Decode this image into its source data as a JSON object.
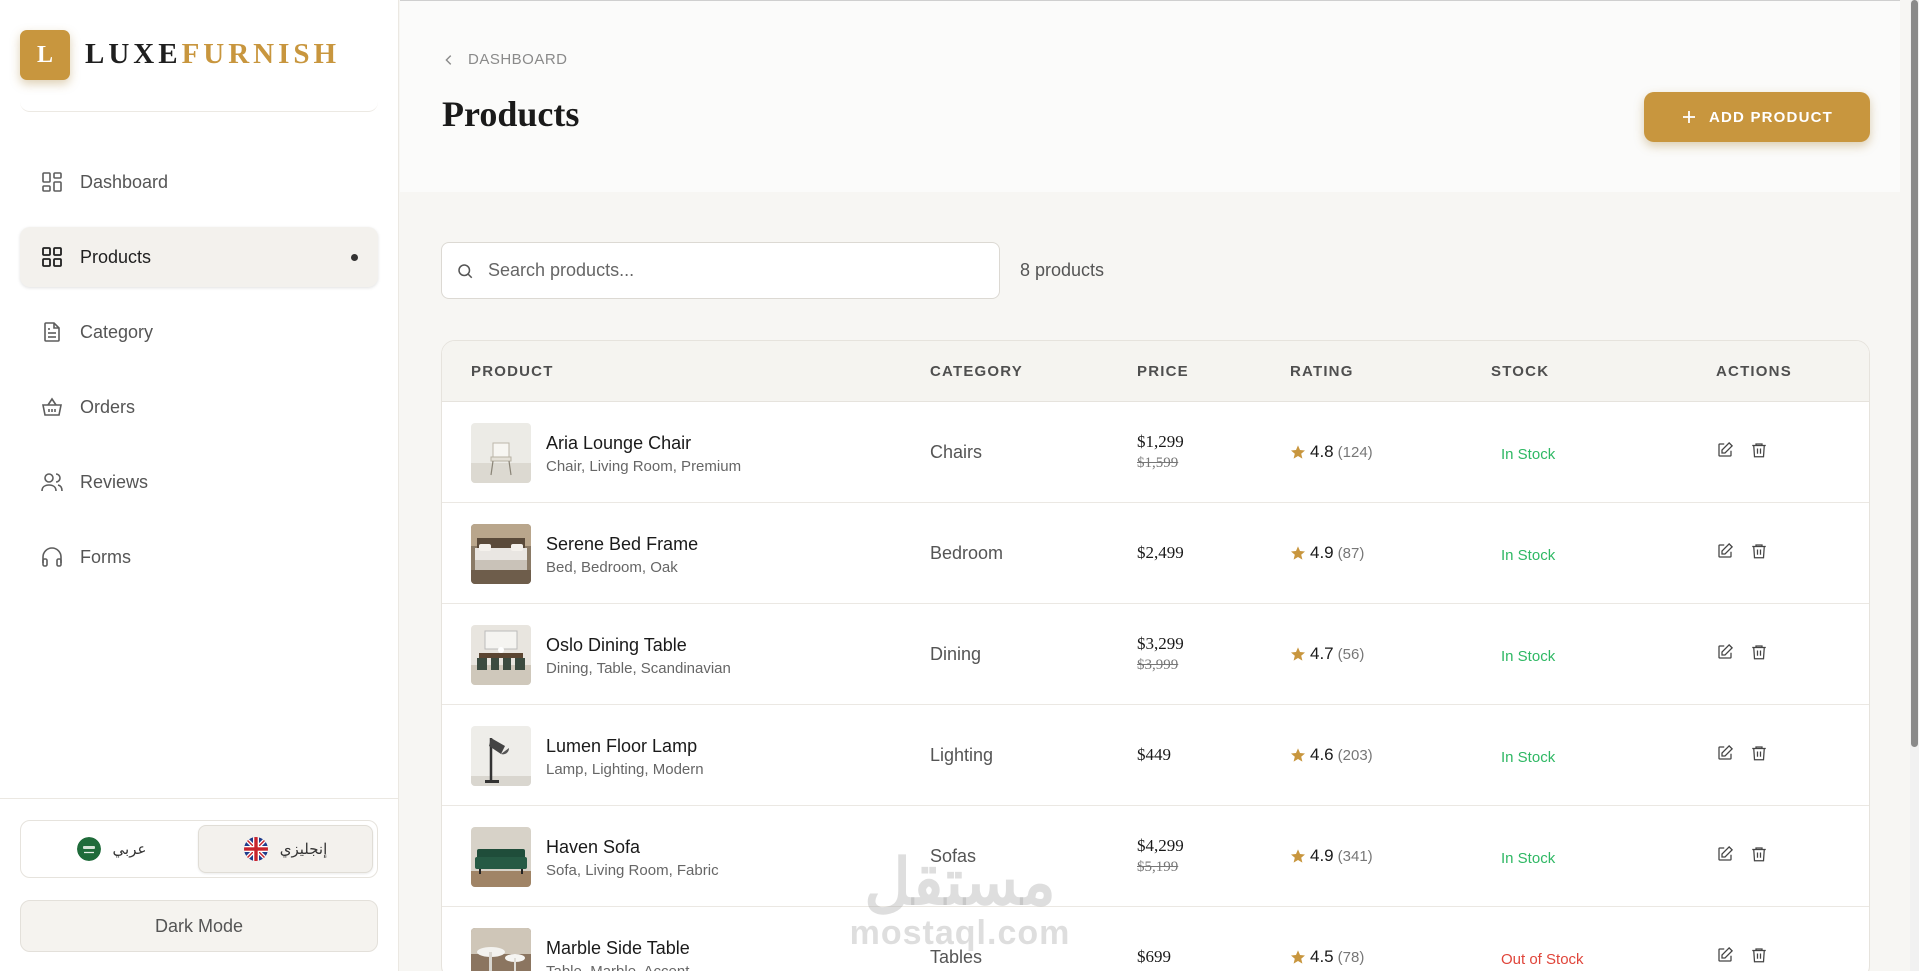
{
  "brand": {
    "logo_letter": "L",
    "name_part1": "LUXE",
    "name_part2": "FURNISH",
    "accent_color": "#c8963e"
  },
  "sidebar": {
    "items": [
      {
        "label": "Dashboard",
        "icon": "dashboard-icon",
        "active": false
      },
      {
        "label": "Products",
        "icon": "grid-icon",
        "active": true
      },
      {
        "label": "Category",
        "icon": "document-icon",
        "active": false
      },
      {
        "label": "Orders",
        "icon": "basket-icon",
        "active": false
      },
      {
        "label": "Reviews",
        "icon": "users-icon",
        "active": false
      },
      {
        "label": "Forms",
        "icon": "headphones-icon",
        "active": false
      }
    ],
    "language": {
      "arabic_label": "عربي",
      "english_label": "إنجليزي",
      "selected": "english"
    },
    "dark_mode_label": "Dark Mode"
  },
  "header": {
    "breadcrumb": "DASHBOARD",
    "title": "Products",
    "add_button_label": "ADD PRODUCT"
  },
  "search": {
    "placeholder": "Search products...",
    "value": ""
  },
  "product_count": "8 products",
  "table": {
    "columns": [
      "PRODUCT",
      "CATEGORY",
      "PRICE",
      "RATING",
      "STOCK",
      "ACTIONS"
    ],
    "rows": [
      {
        "name": "Aria Lounge Chair",
        "tags": "Chair, Living Room, Premium",
        "category": "Chairs",
        "price": "$1,299",
        "old_price": "$1,599",
        "rating": "4.8",
        "reviews": "(124)",
        "stock": "In Stock"
      },
      {
        "name": "Serene Bed Frame",
        "tags": "Bed, Bedroom, Oak",
        "category": "Bedroom",
        "price": "$2,499",
        "old_price": "",
        "rating": "4.9",
        "reviews": "(87)",
        "stock": "In Stock"
      },
      {
        "name": "Oslo Dining Table",
        "tags": "Dining, Table, Scandinavian",
        "category": "Dining",
        "price": "$3,299",
        "old_price": "$3,999",
        "rating": "4.7",
        "reviews": "(56)",
        "stock": "In Stock"
      },
      {
        "name": "Lumen Floor Lamp",
        "tags": "Lamp, Lighting, Modern",
        "category": "Lighting",
        "price": "$449",
        "old_price": "",
        "rating": "4.6",
        "reviews": "(203)",
        "stock": "In Stock"
      },
      {
        "name": "Haven Sofa",
        "tags": "Sofa, Living Room, Fabric",
        "category": "Sofas",
        "price": "$4,299",
        "old_price": "$5,199",
        "rating": "4.9",
        "reviews": "(341)",
        "stock": "In Stock"
      },
      {
        "name": "Marble Side Table",
        "tags": "Table, Marble, Accent",
        "category": "Tables",
        "price": "$699",
        "old_price": "",
        "rating": "4.5",
        "reviews": "(78)",
        "stock": "Out of Stock"
      }
    ]
  },
  "colors": {
    "in_stock": "#2fb864",
    "out_of_stock": "#e0453a",
    "star": "#c8963e"
  },
  "watermark": {
    "arabic": "مستقل",
    "latin": "mostaql.com"
  }
}
